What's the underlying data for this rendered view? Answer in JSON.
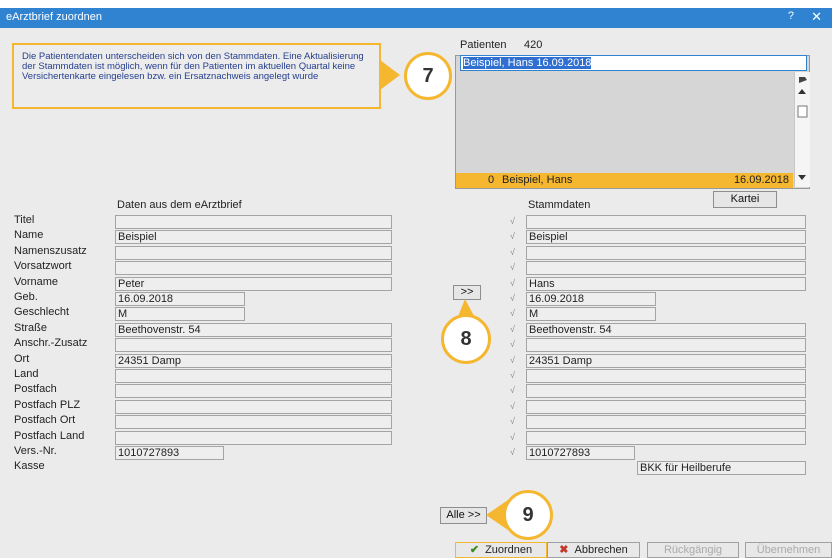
{
  "window": {
    "title": "eArztbrief zuordnen",
    "help": "?",
    "close": "✕"
  },
  "info": {
    "text": "Die Patientendaten unterscheiden sich von den Stammdaten. Eine Aktualisierung der Stammdaten ist möglich, wenn für den Patienten im aktuellen Quartal keine Versichertenkarte eingelesen bzw. ein Ersatznachweis angelegt wurde"
  },
  "badges": [
    "7",
    "8",
    "9"
  ],
  "patients": {
    "label": "Patienten",
    "count": "420",
    "search_value": "Beispiel, Hans  16.09.2018",
    "selected_row": {
      "num": "0",
      "name": "Beispiel, Hans",
      "date": "16.09.2018"
    }
  },
  "buttons": {
    "kartei": "Kartei",
    "transfer": ">>",
    "alle": "Alle >>"
  },
  "headers": {
    "left": "Daten aus dem eArztbrief",
    "right": "Stammdaten"
  },
  "fields": [
    {
      "label": "Titel",
      "left": "",
      "right": ""
    },
    {
      "label": "Name",
      "left": "Beispiel",
      "right": "Beispiel"
    },
    {
      "label": "Namenszusatz",
      "left": "",
      "right": ""
    },
    {
      "label": "Vorsatzwort",
      "left": "",
      "right": ""
    },
    {
      "label": "Vorname",
      "left": "Peter",
      "right": "Hans"
    },
    {
      "label": "Geb.",
      "left": "16.09.2018",
      "right": "16.09.2018"
    },
    {
      "label": "Geschlecht",
      "left": "M",
      "right": "M"
    },
    {
      "label": "Straße",
      "left": "Beethovenstr. 54",
      "right": "Beethovenstr. 54"
    },
    {
      "label": "Anschr.-Zusatz",
      "left": "",
      "right": ""
    },
    {
      "label": "Ort",
      "left": "24351 Damp",
      "right": "24351 Damp"
    },
    {
      "label": "Land",
      "left": "",
      "right": ""
    },
    {
      "label": "Postfach",
      "left": "",
      "right": ""
    },
    {
      "label": "Postfach PLZ",
      "left": "",
      "right": ""
    },
    {
      "label": "Postfach Ort",
      "left": "",
      "right": ""
    },
    {
      "label": "Postfach Land",
      "left": "",
      "right": ""
    },
    {
      "label": "Vers.-Nr.",
      "left": "1010727893",
      "right": "1010727893"
    },
    {
      "label": "Kasse",
      "left": "",
      "right": "BKK für Heilberufe"
    }
  ],
  "check_mark": "√",
  "footer": {
    "zuordnen": "Zuordnen",
    "abbrechen": "Abbrechen",
    "rueckgaengig": "Rückgängig",
    "uebernehmen": "Übernehmen"
  },
  "colors": {
    "accent": "#f5b630",
    "title_bar": "#2f83d1",
    "info_text": "#26408f"
  }
}
